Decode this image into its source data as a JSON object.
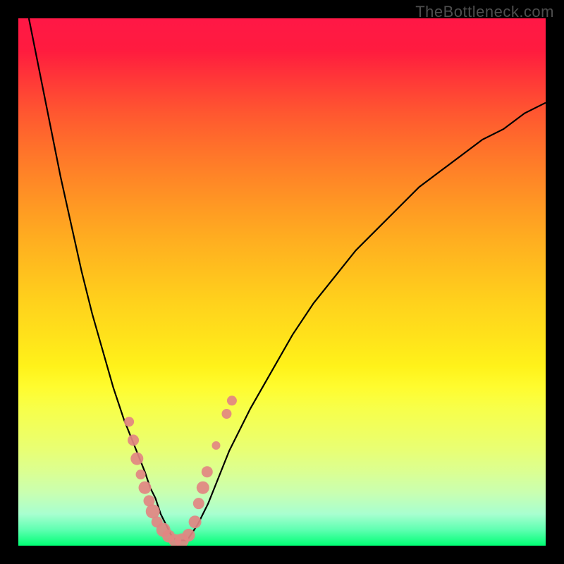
{
  "watermark": "TheBottleneck.com",
  "chart_data": {
    "type": "line",
    "title": "",
    "xlabel": "",
    "ylabel": "",
    "xlim": [
      0,
      100
    ],
    "ylim": [
      0,
      100
    ],
    "grid": false,
    "legend": false,
    "series": [
      {
        "name": "bottleneck-curve",
        "x": [
          2,
          4,
          6,
          8,
          10,
          12,
          14,
          16,
          18,
          20,
          22,
          24,
          25,
          26,
          27,
          28,
          29,
          30,
          32,
          34,
          36,
          38,
          40,
          44,
          48,
          52,
          56,
          60,
          64,
          68,
          72,
          76,
          80,
          84,
          88,
          92,
          96,
          100
        ],
        "y": [
          100,
          90,
          80,
          70,
          61,
          52,
          44,
          37,
          30,
          24,
          19,
          14,
          11,
          9,
          6,
          4,
          2,
          1,
          1,
          4,
          8,
          13,
          18,
          26,
          33,
          40,
          46,
          51,
          56,
          60,
          64,
          68,
          71,
          74,
          77,
          79,
          82,
          84
        ]
      }
    ],
    "markers": {
      "name": "highlighted-points",
      "color": "#e28582",
      "points": [
        {
          "x": 21,
          "y": 23.5,
          "r": 7
        },
        {
          "x": 21.8,
          "y": 20,
          "r": 8
        },
        {
          "x": 22.5,
          "y": 16.5,
          "r": 9
        },
        {
          "x": 23.2,
          "y": 13.5,
          "r": 7
        },
        {
          "x": 24,
          "y": 11,
          "r": 9
        },
        {
          "x": 24.8,
          "y": 8.5,
          "r": 8
        },
        {
          "x": 25.5,
          "y": 6.5,
          "r": 10
        },
        {
          "x": 26.3,
          "y": 4.5,
          "r": 8
        },
        {
          "x": 27.5,
          "y": 3,
          "r": 10
        },
        {
          "x": 28.5,
          "y": 1.8,
          "r": 9
        },
        {
          "x": 29.7,
          "y": 1,
          "r": 9
        },
        {
          "x": 31,
          "y": 1,
          "r": 10
        },
        {
          "x": 32.3,
          "y": 2,
          "r": 9
        },
        {
          "x": 33.5,
          "y": 4.5,
          "r": 9
        },
        {
          "x": 34.2,
          "y": 8,
          "r": 8
        },
        {
          "x": 35,
          "y": 11,
          "r": 9
        },
        {
          "x": 35.8,
          "y": 14,
          "r": 8
        },
        {
          "x": 37.5,
          "y": 19,
          "r": 6
        },
        {
          "x": 39.5,
          "y": 25,
          "r": 7
        },
        {
          "x": 40.5,
          "y": 27.5,
          "r": 7
        }
      ]
    }
  }
}
